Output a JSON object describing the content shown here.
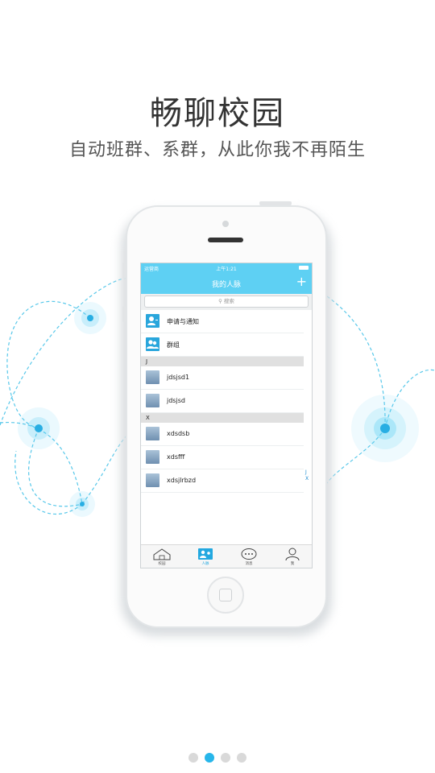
{
  "headline": "畅聊校园",
  "subheadline": "自动班群、系群，从此你我不再陌生",
  "statusbar": {
    "carrier": "运营商",
    "time": "上午1:21"
  },
  "navbar": {
    "title": "我的人脉",
    "add_icon": "plus-icon"
  },
  "search": {
    "placeholder": "搜索"
  },
  "top_items": [
    {
      "label": "申请与通知",
      "icon": "user-notify-icon"
    },
    {
      "label": "群组",
      "icon": "group-icon"
    }
  ],
  "sections": [
    {
      "letter": "J",
      "contacts": [
        "jdsjsd1",
        "jdsjsd"
      ]
    },
    {
      "letter": "X",
      "contacts": [
        "xdsdsb",
        "xdsfff",
        "xdsjlrbzd"
      ]
    }
  ],
  "index_letters": [
    "J",
    "X"
  ],
  "tabs": [
    {
      "label": "校园",
      "icon": "campus-icon",
      "active": false
    },
    {
      "label": "人脉",
      "icon": "contacts-icon",
      "active": true
    },
    {
      "label": "消息",
      "icon": "message-icon",
      "active": false
    },
    {
      "label": "我",
      "icon": "profile-icon",
      "active": false
    }
  ],
  "pager": {
    "count": 4,
    "active_index": 1
  },
  "colors": {
    "accent": "#5ed0f3",
    "active_tab": "#22a8e0",
    "pager_active": "#27b6ea",
    "network_line": "#58c8ea"
  }
}
